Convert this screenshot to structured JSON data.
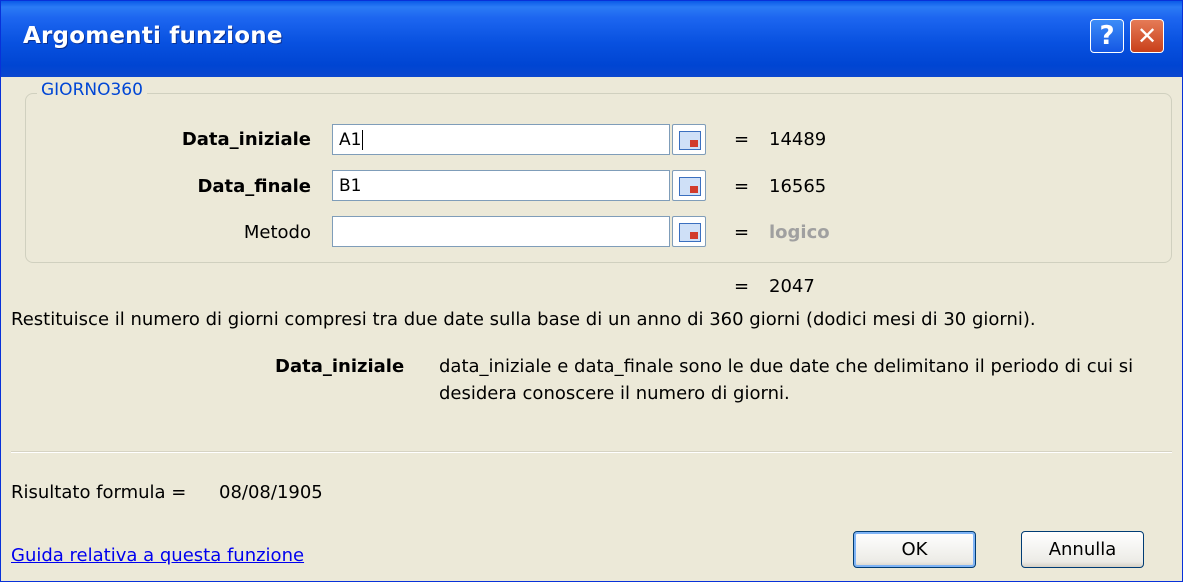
{
  "window": {
    "title": "Argomenti funzione",
    "help_label": "?",
    "close_label": "✕"
  },
  "function": {
    "name": "GIORNO360",
    "args": [
      {
        "label": "Data_iniziale",
        "value": "A1",
        "result": "14489",
        "bold": true
      },
      {
        "label": "Data_finale",
        "value": "B1",
        "result": "16565",
        "bold": true
      },
      {
        "label": "Metodo",
        "value": "",
        "result": "logico",
        "bold": false
      }
    ],
    "equals": "=",
    "overall_result": "2047",
    "description": "Restituisce il numero di giorni compresi tra due date sulla base di un anno di 360 giorni (dodici mesi di 30 giorni).",
    "arg_help_name": "Data_iniziale",
    "arg_help_line1": "data_iniziale e data_finale sono le due date che delimitano il periodo di cui si",
    "arg_help_line2": "desidera conoscere il numero di giorni."
  },
  "footer": {
    "result_label": "Risultato formula =",
    "result_value": "08/08/1905",
    "help_link": "Guida relativa a questa funzione",
    "ok_label": "OK",
    "cancel_label": "Annulla"
  }
}
